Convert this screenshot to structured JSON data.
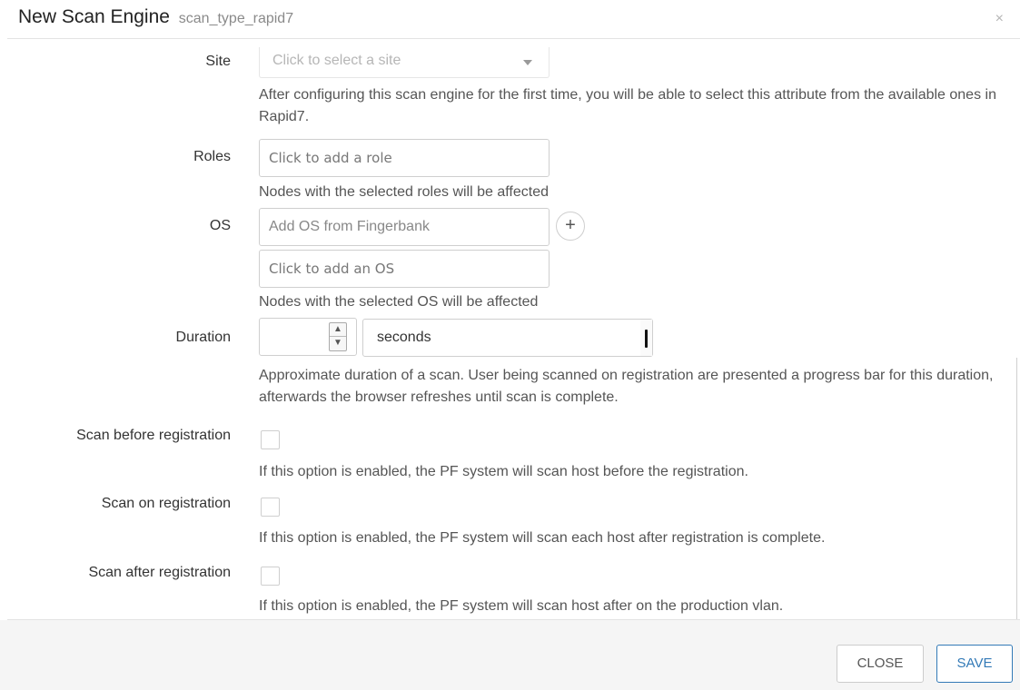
{
  "modal": {
    "title": "New Scan Engine",
    "subtitle": "scan_type_rapid7",
    "close_icon": "×"
  },
  "fields": {
    "site": {
      "label": "Site",
      "placeholder": "Click to select a site",
      "help": "After configuring this scan engine for the first time, you will be able to select this attribute from the available ones in Rapid7."
    },
    "roles": {
      "label": "Roles",
      "placeholder": "Click to add a role",
      "help": "Nodes with the selected roles will be affected"
    },
    "os": {
      "label": "OS",
      "fingerbank_placeholder": "Add OS from Fingerbank",
      "add_icon": "+",
      "placeholder": "Click to add an OS",
      "help": "Nodes with the selected OS will be affected"
    },
    "duration": {
      "label": "Duration",
      "value": "",
      "unit": "seconds",
      "help": "Approximate duration of a scan. User being scanned on registration are presented a progress bar for this duration, afterwards the browser refreshes until scan is complete."
    },
    "scan_before_registration": {
      "label": "Scan before registration",
      "checked": false,
      "help": "If this option is enabled, the PF system will scan host before the registration."
    },
    "scan_on_registration": {
      "label": "Scan on registration",
      "checked": false,
      "help": "If this option is enabled, the PF system will scan each host after registration is complete."
    },
    "scan_after_registration": {
      "label": "Scan after registration",
      "checked": false,
      "help": "If this option is enabled, the PF system will scan host after on the production vlan."
    }
  },
  "footer": {
    "close_label": "CLOSE",
    "save_label": "SAVE"
  },
  "colors": {
    "primary": "#337ab7",
    "footer_bg": "#f5f5f5"
  }
}
